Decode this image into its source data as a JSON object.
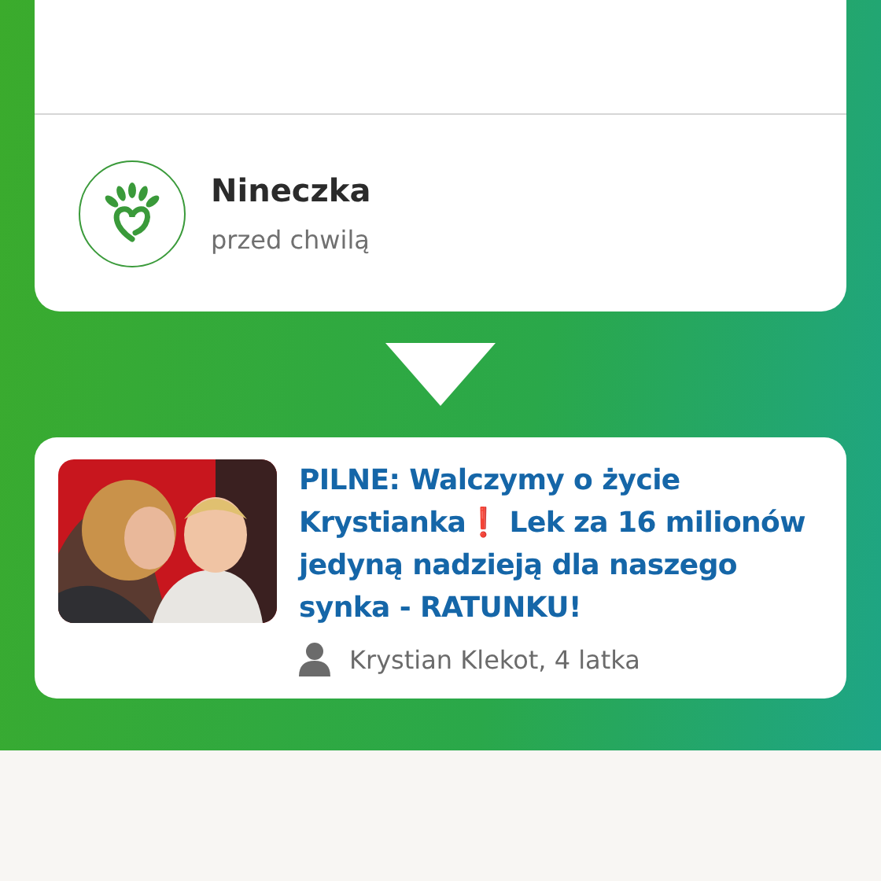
{
  "donation": {
    "donor": "Nineczka",
    "time": "przed chwilą"
  },
  "fundraiser": {
    "title": "PILNE: Walczymy o życie Krystianka❗ Lek za 16 milionów jedyną nadzieją dla naszego synka - RATUNKU!",
    "beneficiary": "Krystian Klekot, 4 latka"
  }
}
